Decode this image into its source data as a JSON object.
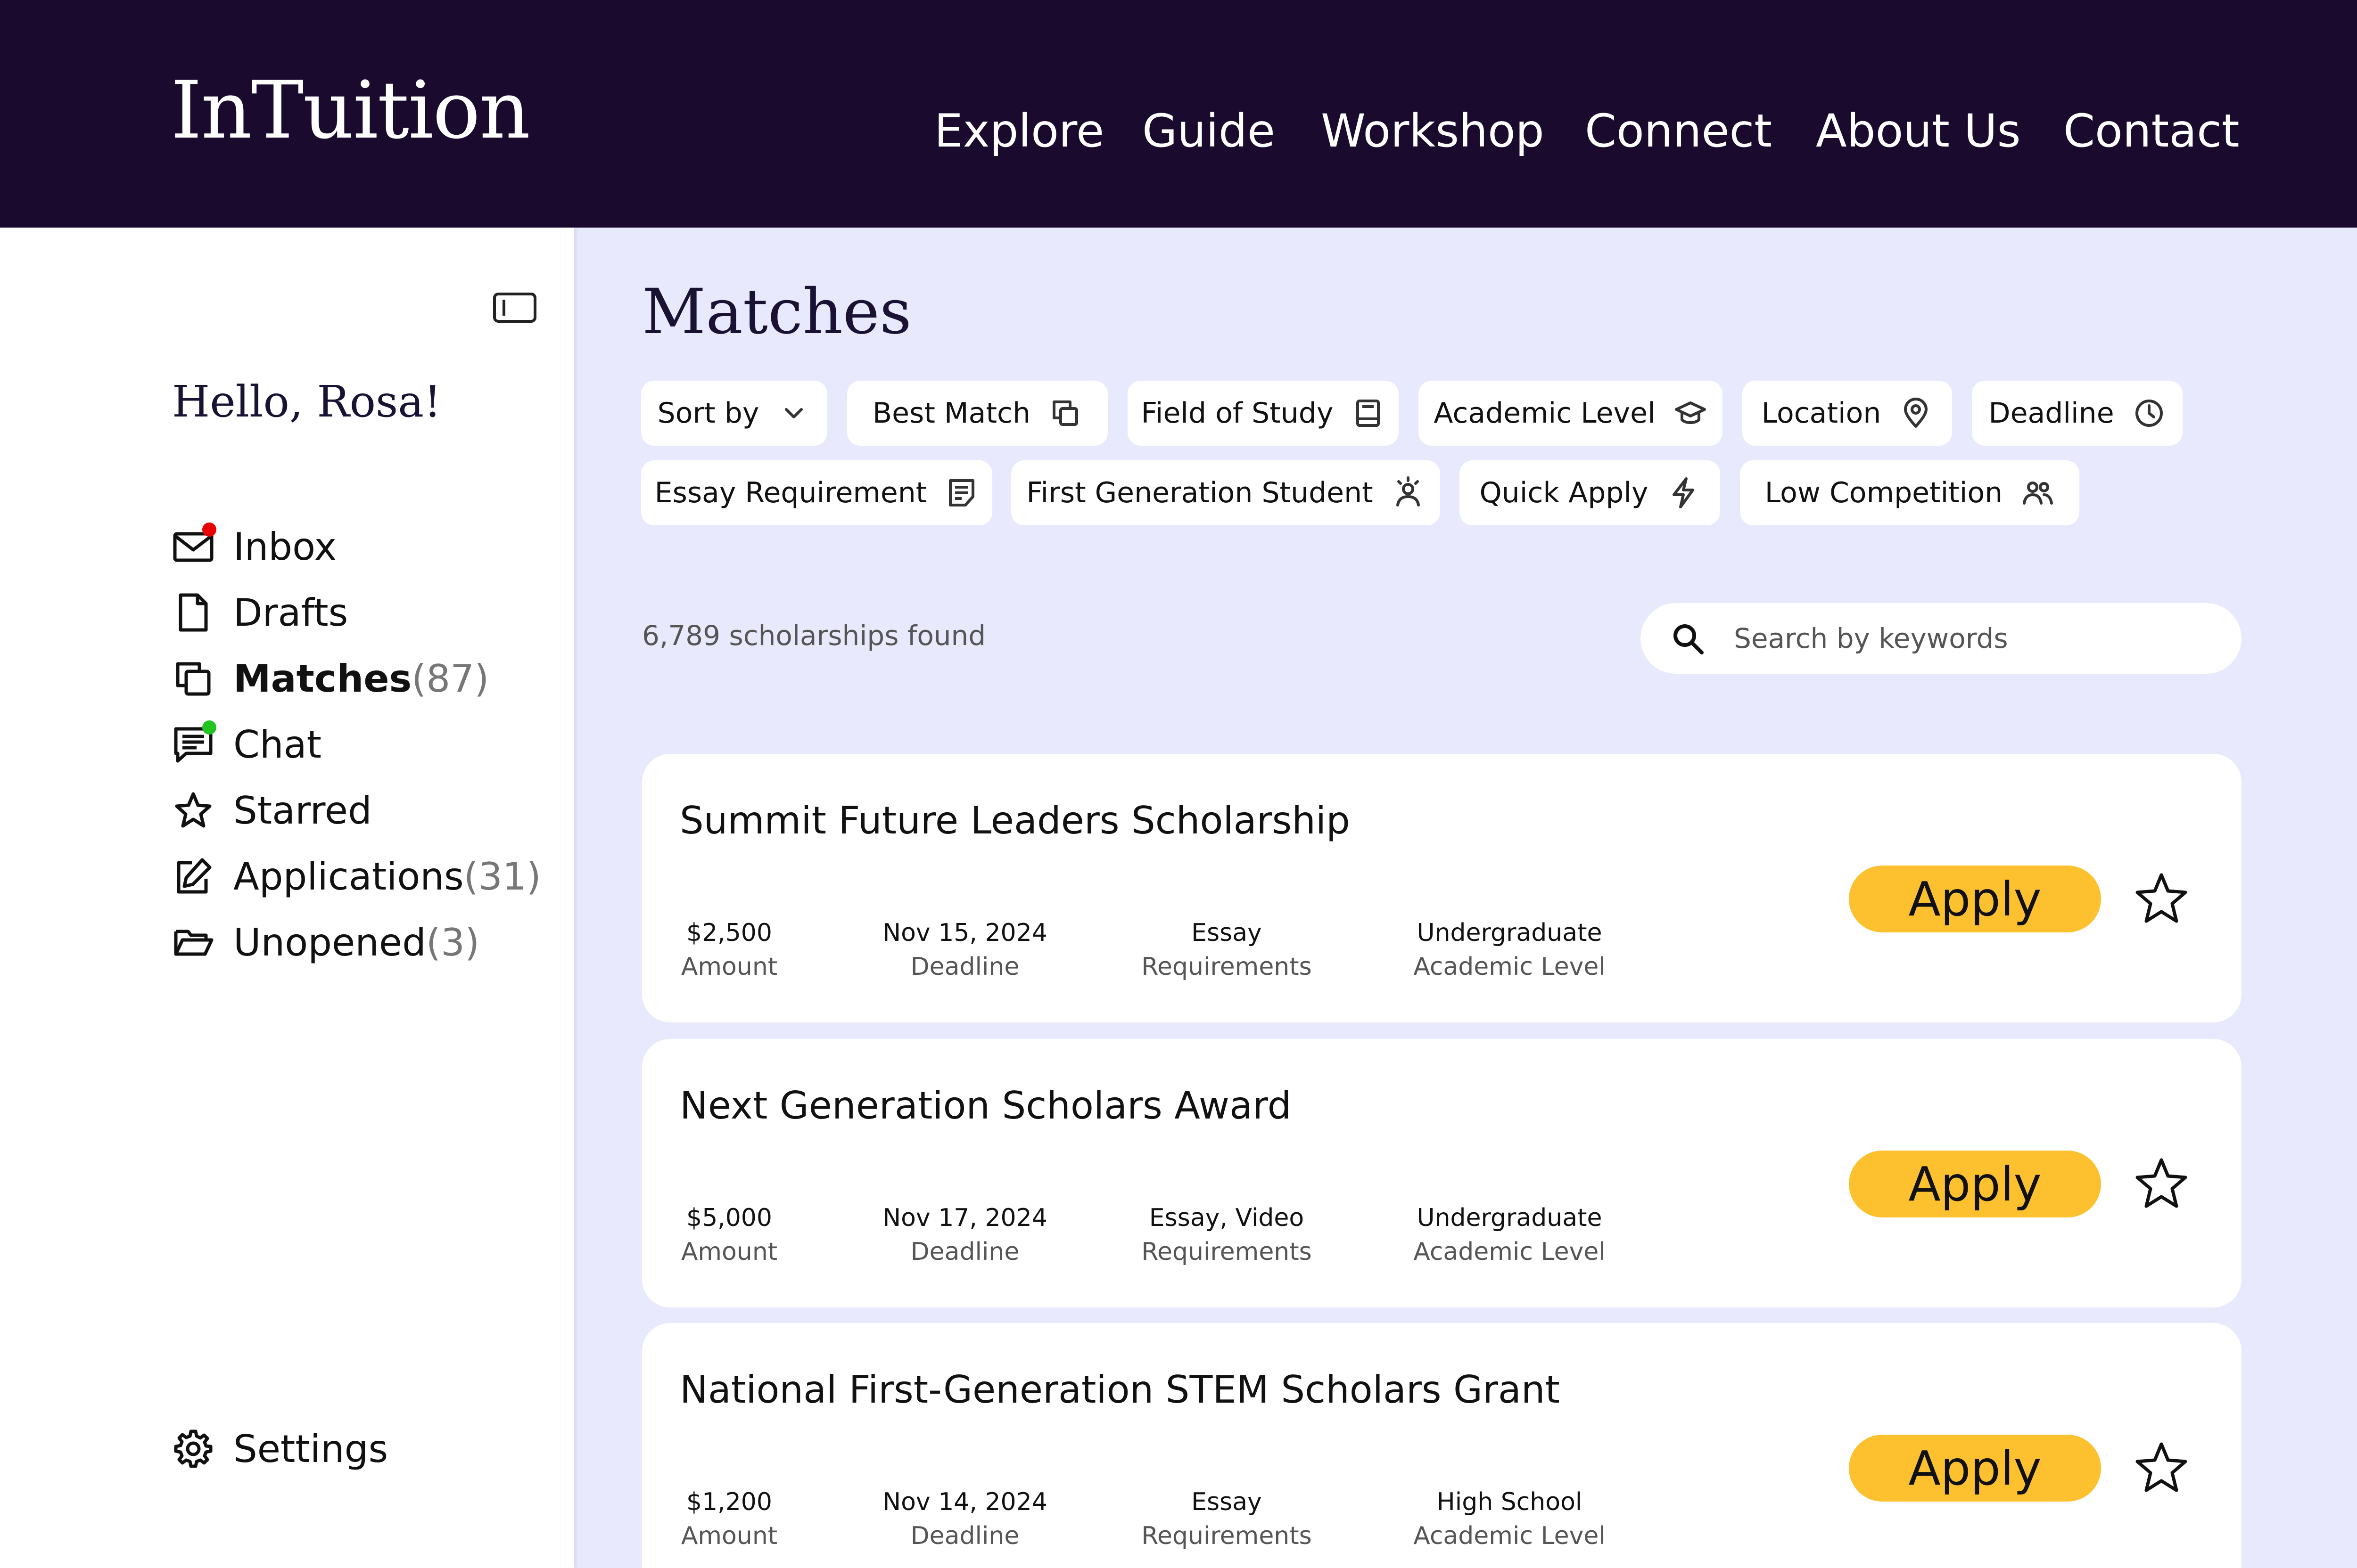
{
  "app": {
    "logo": "InTuition"
  },
  "nav": [
    "Explore",
    "Guide",
    "Workshop",
    "Connect",
    "About Us",
    "Contact"
  ],
  "sidebar": {
    "greeting": "Hello, Rosa!",
    "items": [
      {
        "label": "Inbox",
        "count": "",
        "icon": "mail-icon",
        "badge_color": "#e60000"
      },
      {
        "label": "Drafts",
        "count": "",
        "icon": "document-icon"
      },
      {
        "label": "Matches",
        "count": "(87)",
        "icon": "copy-icon",
        "active": true
      },
      {
        "label": "Chat",
        "count": "",
        "icon": "chat-icon",
        "badge_color": "#22c322"
      },
      {
        "label": "Starred",
        "count": "",
        "icon": "star-icon"
      },
      {
        "label": "Applications",
        "count": "(31)",
        "icon": "edit-icon"
      },
      {
        "label": "Unopened",
        "count": "(3)",
        "icon": "folder-open-icon"
      }
    ],
    "settings_label": "Settings"
  },
  "main": {
    "title": "Matches",
    "filters": [
      {
        "label": "Sort by",
        "icon": "chevron-down-icon"
      },
      {
        "label": "Best Match",
        "icon": "copy-icon"
      },
      {
        "label": "Field of Study",
        "icon": "book-icon"
      },
      {
        "label": "Academic Level",
        "icon": "graduation-cap-icon"
      },
      {
        "label": "Location",
        "icon": "location-pin-icon"
      },
      {
        "label": "Deadline",
        "icon": "clock-icon"
      },
      {
        "label": "Essay Requirement",
        "icon": "document-lines-icon"
      },
      {
        "label": "First Generation Student",
        "icon": "person-sparkle-icon"
      },
      {
        "label": "Quick Apply",
        "icon": "lightning-icon"
      },
      {
        "label": "Low Competition",
        "icon": "users-icon"
      }
    ],
    "results_count": "6,789 scholarships found",
    "search_placeholder": "Search by keywords",
    "apply_label": "Apply",
    "field_labels": {
      "amount": "Amount",
      "deadline": "Deadline",
      "requirements": "Requirements",
      "level": "Academic Level"
    },
    "scholarships": [
      {
        "title": "Summit Future Leaders Scholarship",
        "amount": "$2,500",
        "deadline": "Nov 15, 2024",
        "requirements": "Essay",
        "level": "Undergraduate"
      },
      {
        "title": "Next Generation Scholars Award",
        "amount": "$5,000",
        "deadline": "Nov 17, 2024",
        "requirements": "Essay, Video",
        "level": "Undergraduate"
      },
      {
        "title": "National First-Generation STEM Scholars Grant",
        "amount": "$1,200",
        "deadline": "Nov 14, 2024",
        "requirements": "Essay",
        "level": "High School"
      }
    ]
  },
  "colors": {
    "header_bg": "#1a0b2e",
    "page_bg": "#e9e9fd",
    "apply_button": "#fdc12f"
  }
}
